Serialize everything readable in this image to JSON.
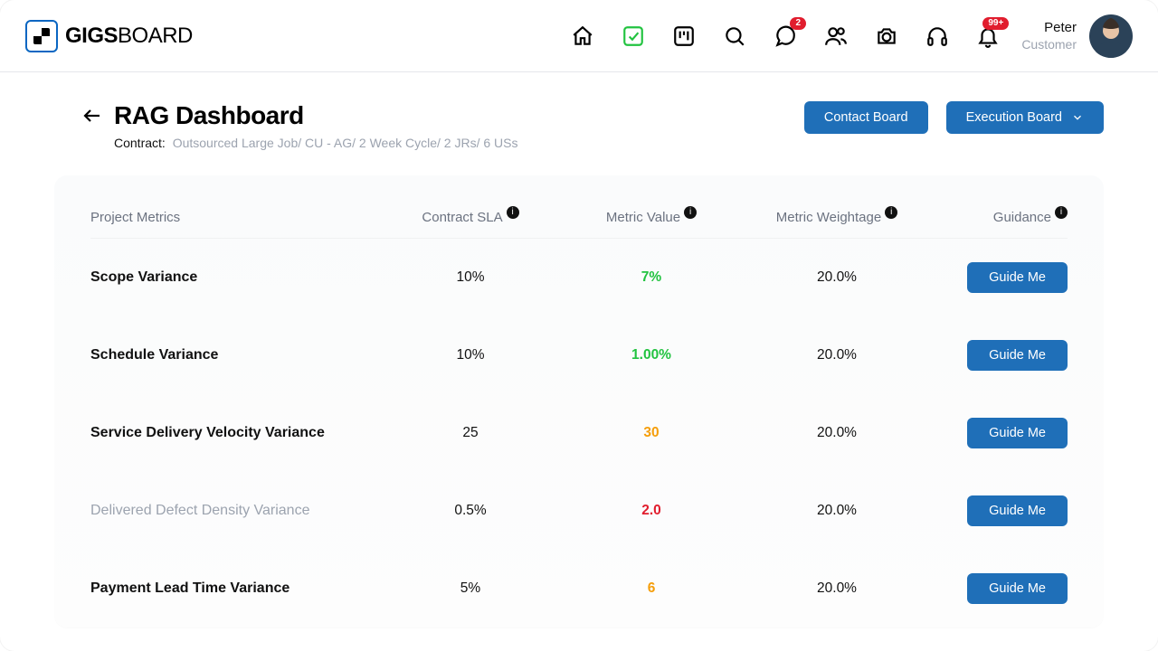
{
  "logo": {
    "text_bold": "GIGS",
    "text_light": "BOARD"
  },
  "nav": {
    "chat_badge": "2",
    "bell_badge": "99+"
  },
  "user": {
    "name": "Peter",
    "role": "Customer"
  },
  "page": {
    "title": "RAG Dashboard",
    "contract_label": "Contract:",
    "contract_value": "Outsourced Large Job/ CU - AG/ 2 Week Cycle/ 2 JRs/ 6 USs"
  },
  "actions": {
    "contact_board": "Contact Board",
    "execution_board": "Execution Board"
  },
  "table": {
    "headers": {
      "metrics": "Project Metrics",
      "sla": "Contract SLA",
      "value": "Metric Value",
      "weightage": "Metric Weightage",
      "guidance": "Guidance"
    },
    "guide_label": "Guide Me",
    "rows": [
      {
        "name": "Scope Variance",
        "sla": "10%",
        "value": "7%",
        "value_state": "green",
        "weight": "20.0%",
        "muted": false
      },
      {
        "name": "Schedule Variance",
        "sla": "10%",
        "value": "1.00%",
        "value_state": "green",
        "weight": "20.0%",
        "muted": false
      },
      {
        "name": "Service Delivery Velocity Variance",
        "sla": "25",
        "value": "30",
        "value_state": "amber",
        "weight": "20.0%",
        "muted": false
      },
      {
        "name": "Delivered Defect Density Variance",
        "sla": "0.5%",
        "value": "2.0",
        "value_state": "red",
        "weight": "20.0%",
        "muted": true
      },
      {
        "name": "Payment Lead Time Variance",
        "sla": "5%",
        "value": "6",
        "value_state": "amber",
        "weight": "20.0%",
        "muted": false
      }
    ]
  }
}
